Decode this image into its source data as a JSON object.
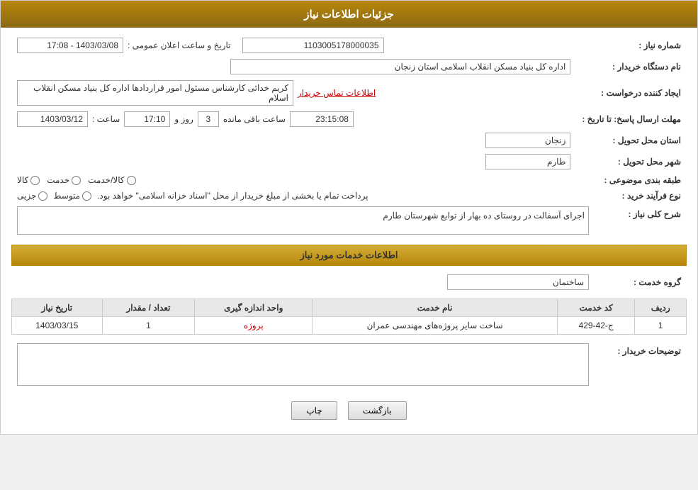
{
  "header": {
    "title": "جزئیات اطلاعات نیاز"
  },
  "fields": {
    "shomara_niaz_label": "شماره نیاز :",
    "shomara_niaz_value": "1103005178000035",
    "darkhast_label": "نام دستگاه خریدار :",
    "darkhast_value": "اداره کل بنیاد مسکن انقلاب اسلامی استان زنجان",
    "ijad_label": "ایجاد کننده درخواست :",
    "ijad_value": "کریم خدائی کارشناس مسئول امور قراردادها اداره کل بنیاد مسکن انقلاب اسلام",
    "contact_link": "اطلاعات تماس خریدار",
    "mohlat_label": "مهلت ارسال پاسخ: تا تاریخ :",
    "date_value": "1403/03/12",
    "time_label": "ساعت :",
    "time_value": "17:10",
    "rooz_label": "روز و",
    "rooz_value": "3",
    "baqi_label": "ساعت باقی مانده",
    "baqi_value": "23:15:08",
    "tarikhe_ijad_label": "تاریخ و ساعت اعلان عمومی :",
    "tarikhe_ijad_value": "1403/03/08 - 17:08",
    "ostan_label": "استان محل تحویل :",
    "ostan_value": "زنجان",
    "shahr_label": "شهر محل تحویل :",
    "shahr_value": "طارم",
    "tabaqe_label": "طبقه بندی موضوعی :",
    "kala_label": "کالا",
    "khedmat_label": "خدمت",
    "kala_khedmat_label": "کالا/خدمت",
    "noE_farayand_label": "نوع فرآیند خرید :",
    "jozyi_label": "جزیی",
    "motaset_label": "متوسط",
    "farayand_desc": "پرداخت تمام یا بخشی از مبلغ خریدار از محل \"اسناد خزانه اسلامی\" خواهد بود.",
    "sharh_label": "شرح کلی نیاز :",
    "sharh_value": "اجرای آسفالت در روستای  ده بهار از توابع شهرستان طارم",
    "khadamat_section_title": "اطلاعات خدمات مورد نیاز",
    "grooh_khedmat_label": "گروه خدمت :",
    "grooh_khedmat_value": "ساختمان",
    "table": {
      "headers": [
        "ردیف",
        "کد خدمت",
        "نام خدمت",
        "واحد اندازه گیری",
        "تعداد / مقدار",
        "تاریخ نیاز"
      ],
      "rows": [
        {
          "radif": "1",
          "kod": "ج-42-429",
          "name": "ساخت سایر پروژه‌های مهندسی عمران",
          "vahed": "پروژه",
          "tedad": "1",
          "tarikh": "1403/03/15"
        }
      ]
    },
    "tozihat_label": "توضیحات خریدار :",
    "tozihat_value": "",
    "btn_chap": "چاپ",
    "btn_bazgasht": "بازگشت"
  }
}
